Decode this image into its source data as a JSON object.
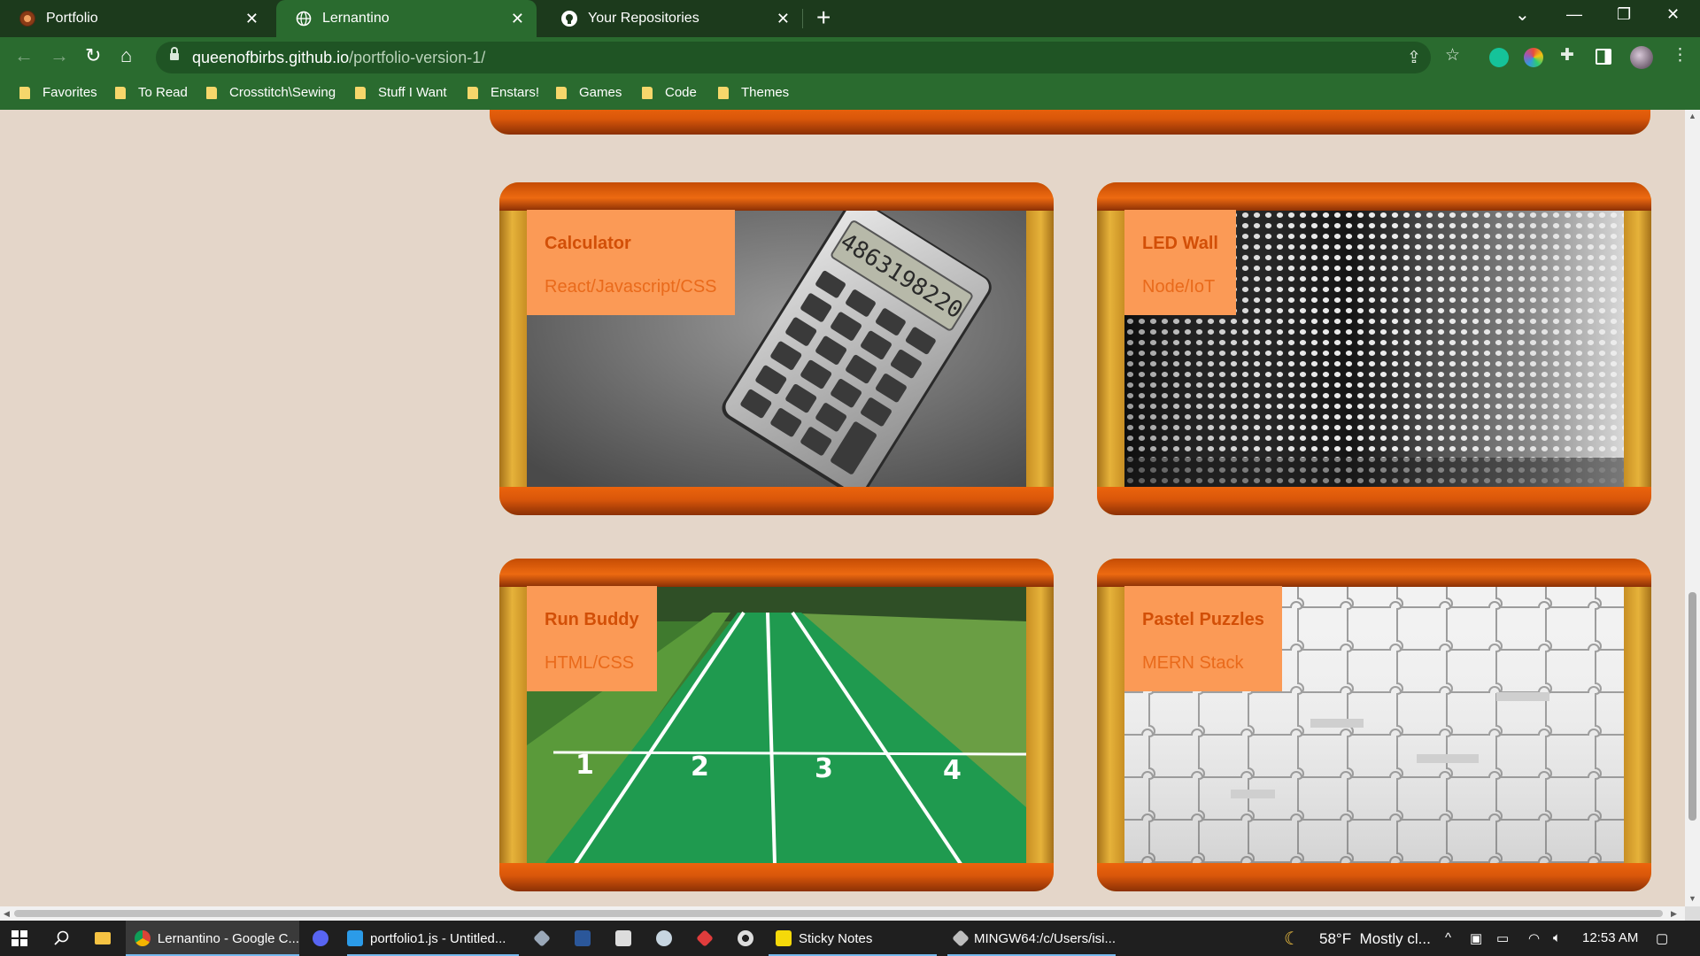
{
  "browser": {
    "tabs": [
      {
        "title": "Portfolio",
        "icon": "portfolio-favicon",
        "active": false
      },
      {
        "title": "Lernantino",
        "icon": "globe-icon",
        "active": true
      },
      {
        "title": "Your Repositories",
        "icon": "github-icon",
        "active": false
      }
    ],
    "url": {
      "host": "queenofbirbs.github.io",
      "path": "/portfolio-version-1/"
    },
    "bookmarks": [
      "Favorites",
      "To Read",
      "Crosstitch\\Sewing",
      "Stuff I Want",
      "Enstars!",
      "Games",
      "Code",
      "Themes"
    ]
  },
  "projects": [
    {
      "title": "Calculator",
      "tech": "React/Javascript/CSS",
      "image": "calculator-photo"
    },
    {
      "title": "LED Wall",
      "tech": "Node/IoT",
      "image": "led-wall-photo"
    },
    {
      "title": "Run Buddy",
      "tech": "HTML/CSS",
      "image": "running-track-photo"
    },
    {
      "title": "Pastel Puzzles",
      "tech": "MERN Stack",
      "image": "puzzle-pieces-photo"
    }
  ],
  "taskbar": {
    "apps": [
      {
        "label": "Lernantino - Google C...",
        "icon": "chrome-icon",
        "active": true
      },
      {
        "label": "",
        "icon": "discord-icon"
      },
      {
        "label": "portfolio1.js - Untitled...",
        "icon": "vscode-icon"
      },
      {
        "label": "",
        "icon": "git-icon"
      },
      {
        "label": "",
        "icon": "word-icon"
      },
      {
        "label": "",
        "icon": "7zip-icon"
      },
      {
        "label": "",
        "icon": "steam-icon"
      },
      {
        "label": "",
        "icon": "app-icon"
      },
      {
        "label": "",
        "icon": "obs-icon"
      },
      {
        "label": "Sticky Notes",
        "icon": "sticky-notes-icon"
      },
      {
        "label": "MINGW64:/c/Users/isi...",
        "icon": "git-bash-icon"
      }
    ],
    "weather": "58°F  Mostly cl...",
    "time": "12:53 AM"
  },
  "colors": {
    "page_bg": "#e4d6c9",
    "chrome_green": "#2a6b2f",
    "frame_orange": "#ec640c",
    "frame_gold": "#d9a32c",
    "label_bg": "#fb9a56",
    "label_title": "#d24f07"
  }
}
